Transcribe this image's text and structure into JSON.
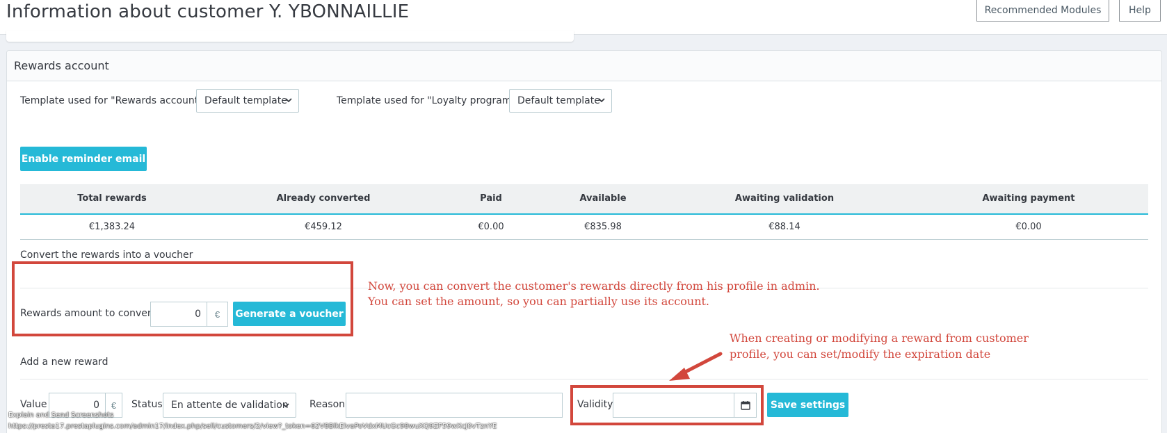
{
  "page": {
    "title": "Information about customer Y. YBONNAILLIE",
    "toolbar": {
      "recommended_modules": "Recommended Modules",
      "help": "Help"
    }
  },
  "rewards_card": {
    "title": "Rewards account",
    "template_rewards_label": "Template used for \"Rewards account\"",
    "template_rewards_value": "Default template",
    "template_loyalty_label": "Template used for \"Loyalty program\"",
    "template_loyalty_value": "Default template",
    "enable_reminder": "Enable reminder email",
    "table": {
      "headers": [
        "Total rewards",
        "Already converted",
        "Paid",
        "Available",
        "Awaiting validation",
        "Awaiting payment"
      ],
      "row": [
        "€1,383.24",
        "€459.12",
        "€0.00",
        "€835.98",
        "€88.14",
        "€0.00"
      ]
    },
    "convert": {
      "title": "Convert the rewards into a voucher",
      "amount_label": "Rewards amount to convert",
      "amount_value": "0",
      "currency": "€",
      "generate_button": "Generate a voucher"
    },
    "new_reward": {
      "title": "Add a new reward",
      "value_label": "Value",
      "value_value": "0",
      "currency": "€",
      "status_label": "Status",
      "status_value": "En attente de validation",
      "reason_label": "Reason",
      "reason_value": "",
      "validity_label": "Validity",
      "validity_value": "",
      "save_button": "Save settings"
    }
  },
  "annotations": {
    "convert_note_line1": "Now, you can convert the customer's rewards directly from his profile in admin.",
    "convert_note_line2": "You can set the amount, so you can partially use its account.",
    "validity_note_line1": "When creating or modifying a reward from customer",
    "validity_note_line2": "profile, you can set/modify the expiration date"
  },
  "status_bar": {
    "line1": "Explain and Send Screenshots",
    "line2": "https://presta17.prestaplugins.com/admin17/index.php/sell/customers/2/view?_token=62V8BlkEivaPoVdxMUcGc98wuXQ9ZF59wXcJ0vTznYE"
  },
  "colors": {
    "accent": "#25b9d7",
    "annotation_red": "#d2473c",
    "table_header_bg": "#eff1f2"
  }
}
